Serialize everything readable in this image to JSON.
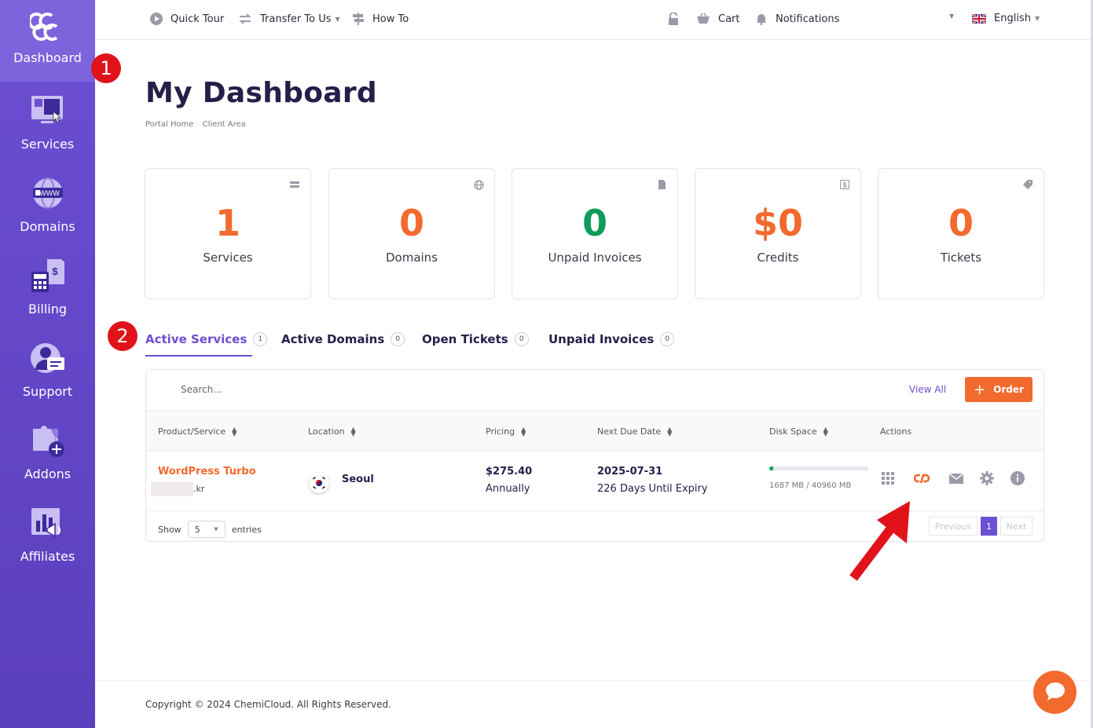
{
  "brand": {
    "logo_icon": "chemicloud-logo"
  },
  "sidebar": {
    "items": [
      {
        "label": "Dashboard",
        "icon": "dashboard-logo"
      },
      {
        "label": "Services",
        "icon": "services-icon"
      },
      {
        "label": "Domains",
        "icon": "www-globe-icon"
      },
      {
        "label": "Billing",
        "icon": "billing-icon"
      },
      {
        "label": "Support",
        "icon": "support-agent-icon"
      },
      {
        "label": "Addons",
        "icon": "puzzle-plus-icon"
      },
      {
        "label": "Affiliates",
        "icon": "affiliates-megaphone-icon"
      }
    ]
  },
  "topbar": {
    "quick_tour": "Quick Tour",
    "transfer": "Transfer To Us",
    "howto": "How To",
    "cart": "Cart",
    "notifications": "Notifications",
    "language": "English"
  },
  "main": {
    "title": "My Dashboard",
    "breadcrumb": [
      "Portal Home",
      "Client Area"
    ]
  },
  "stats": [
    {
      "value": "1",
      "label": "Services",
      "color": "#f26a2e",
      "icon": "server-icon"
    },
    {
      "value": "0",
      "label": "Domains",
      "color": "#f26a2e",
      "icon": "globe-icon"
    },
    {
      "value": "0",
      "label": "Unpaid Invoices",
      "color": "#0f9b5a",
      "icon": "document-icon"
    },
    {
      "value": "$0",
      "label": "Credits",
      "color": "#f26a2e",
      "icon": "credit-icon"
    },
    {
      "value": "0",
      "label": "Tickets",
      "color": "#f26a2e",
      "icon": "tag-icon"
    }
  ],
  "markers": [
    "1",
    "2"
  ],
  "tabs": [
    {
      "label": "Active Services",
      "count": "1"
    },
    {
      "label": "Active Domains",
      "count": "0"
    },
    {
      "label": "Open Tickets",
      "count": "0"
    },
    {
      "label": "Unpaid Invoices",
      "count": "0"
    }
  ],
  "table": {
    "search_placeholder": "Search...",
    "view_all": "View All",
    "order": "Order",
    "columns": [
      "Product/Service",
      "Location",
      "Pricing",
      "Next Due Date",
      "Disk Space",
      "Actions"
    ],
    "row": {
      "product": "WordPress Turbo",
      "domain_suffix": ".kr",
      "location": "Seoul",
      "price": "$275.40",
      "cycle": "Annually",
      "due_date": "2025-07-31",
      "expiry": "226 Days Until Expiry",
      "disk": "1687 MB / 40960 MB",
      "disk_fraction": 0.041
    },
    "show": "Show",
    "entries_value": "5",
    "entries": "entries",
    "prev": "Previous",
    "page": "1",
    "next": "Next"
  },
  "footer": {
    "copyright": "Copyright © 2024 ChemiCloud. All Rights Reserved."
  },
  "colors": {
    "accent": "#6c4fd2",
    "orange": "#f26a2e",
    "green": "#0f9b5a",
    "marker_red": "#e0131b"
  }
}
